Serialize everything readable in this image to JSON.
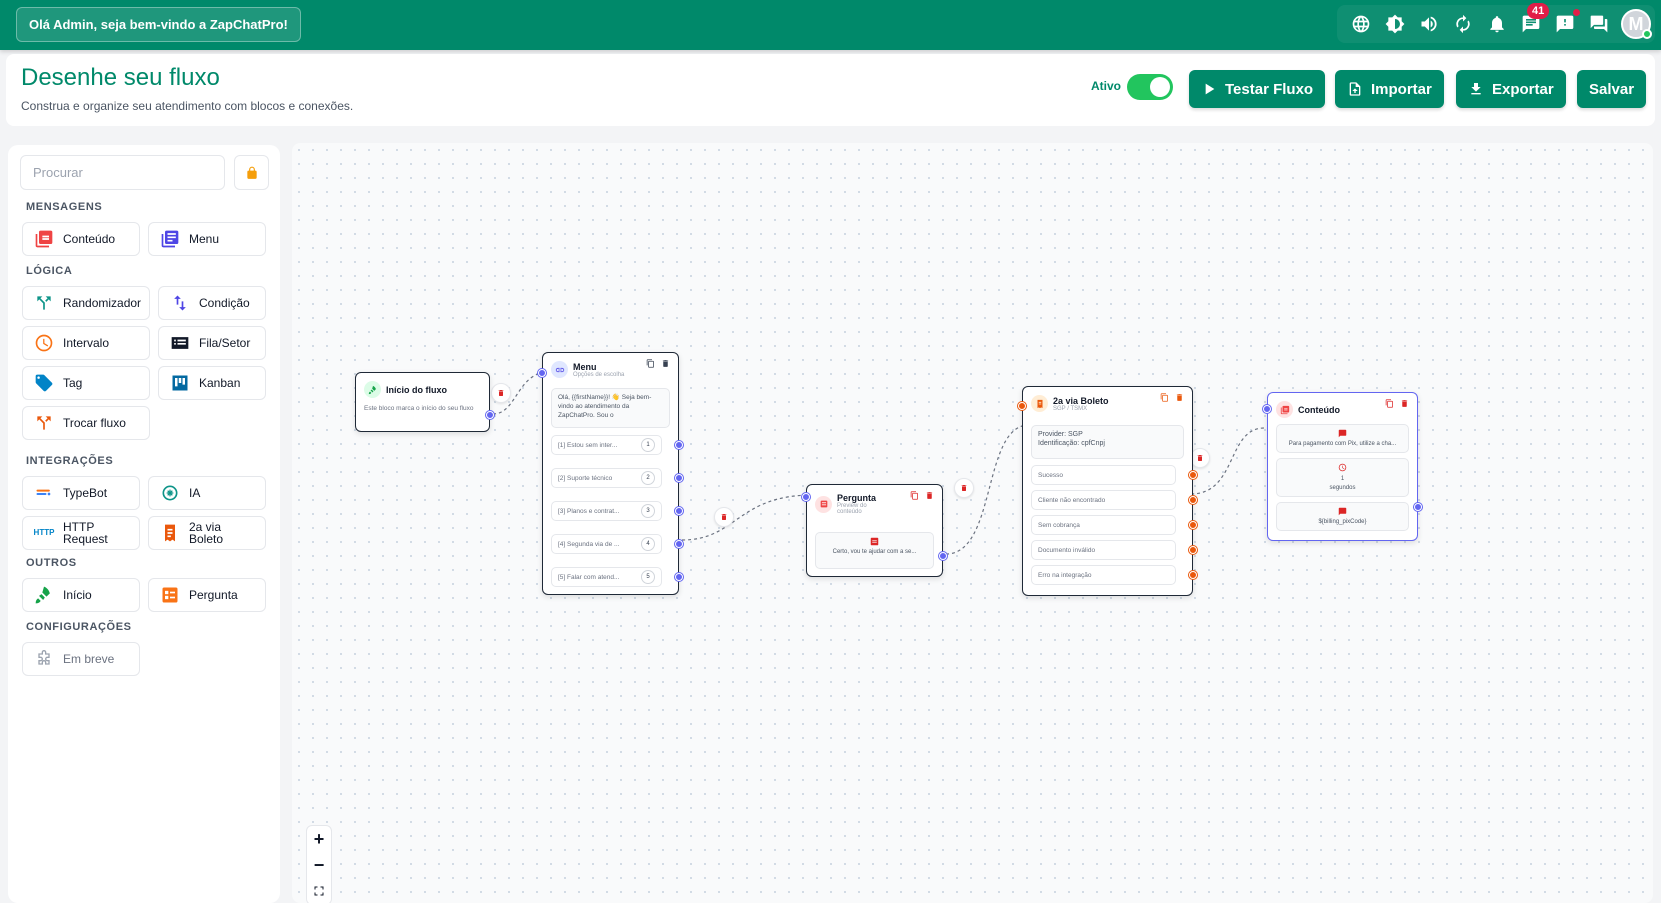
{
  "topbar": {
    "welcome": "Olá Admin, seja bem-vindo a ZapChatPro!",
    "chat_badge": "41",
    "avatar_initial": "M",
    "icons": [
      "globe-icon",
      "brightness-icon",
      "volume-icon",
      "refresh-icon",
      "bell-icon",
      "chat-icon",
      "alert-icon",
      "messages-icon"
    ]
  },
  "header": {
    "title": "Desenhe seu fluxo",
    "subtitle": "Construa e organize seu atendimento com blocos e conexões.",
    "ativo_label": "Ativo",
    "ativo_on": true,
    "buttons": {
      "test": "Testar Fluxo",
      "import": "Importar",
      "export": "Exportar",
      "save": "Salvar"
    }
  },
  "sidebar": {
    "search_placeholder": "Procurar",
    "sections": {
      "mensagens": "MENSAGENS",
      "logica": "LÓGICA",
      "integracoes": "INTEGRAÇÕES",
      "outros": "OUTROS",
      "configuracoes": "CONFIGURAÇÕES"
    },
    "blocks": {
      "conteudo": "Conteúdo",
      "menu": "Menu",
      "randomizador": "Randomizador",
      "condicao": "Condição",
      "intervalo": "Intervalo",
      "fila": "Fila/Setor",
      "tag": "Tag",
      "kanban": "Kanban",
      "trocar": "Trocar fluxo",
      "typebot": "TypeBot",
      "ia": "IA",
      "http_1": "HTTP",
      "http_2": "Request",
      "http_icon": "HTTP",
      "boleto_1": "2a via",
      "boleto_2": "Boleto",
      "inicio": "Início",
      "pergunta": "Pergunta",
      "embreve": "Em breve"
    }
  },
  "nodes": {
    "inicio": {
      "title": "Início do fluxo",
      "desc": "Este bloco marca o início do seu fluxo"
    },
    "menu": {
      "title": "Menu",
      "subtitle": "Opções de escolha",
      "message": "Olá, {{firstName}}! 👋 Seja bem-vindo ao atendimento da ZapChatPro. Sou o",
      "options": [
        {
          "label": "[1] Estou sem inter...",
          "num": "1"
        },
        {
          "label": "[2] Suporte técnico",
          "num": "2"
        },
        {
          "label": "[3] Planos e contrat...",
          "num": "3"
        },
        {
          "label": "[4] Segunda via de ...",
          "num": "4"
        },
        {
          "label": "[5] Falar com atend...",
          "num": "5"
        }
      ]
    },
    "pergunta": {
      "title": "Pergunta",
      "subtitle": "Preview do conteúdo",
      "content": "Certo, vou te ajudar com a se..."
    },
    "boleto": {
      "title": "2a via Boleto",
      "subtitle": "SGP / TSMX",
      "provider": "Provider: SGP",
      "ident": "Identificação: cpfCnpj",
      "outputs": [
        "Sucesso",
        "Cliente não encontrado",
        "Sem cobrança",
        "Documento inválido",
        "Erro na integração"
      ]
    },
    "conteudo": {
      "title": "Conteúdo",
      "msg1": "Para pagamento com Pix, utilize a cha...",
      "interval_value": "1",
      "interval_unit": "segundos",
      "msg2": "${billing_pixCode}"
    }
  },
  "zoom": {
    "in": "+",
    "out": "−"
  },
  "colors": {
    "brand": "#00896a",
    "accent": "#6366f1",
    "danger": "#dc2626",
    "orange": "#ea580c"
  }
}
